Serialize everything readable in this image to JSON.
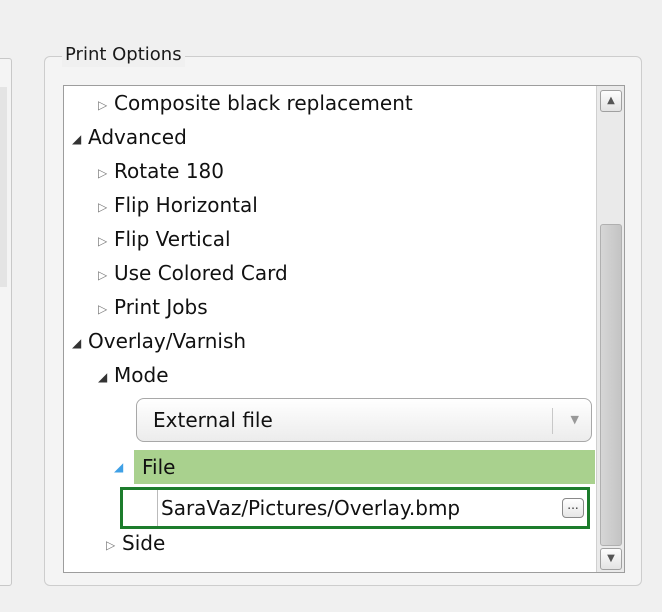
{
  "group_title": "Print Options",
  "tree": {
    "items": [
      {
        "label": "Composite black replacement"
      },
      {
        "label": "Advanced"
      },
      {
        "label": "Rotate 180"
      },
      {
        "label": "Flip Horizontal"
      },
      {
        "label": "Flip Vertical"
      },
      {
        "label": "Use Colored Card"
      },
      {
        "label": "Print Jobs"
      },
      {
        "label": "Overlay/Varnish"
      },
      {
        "label": "Mode"
      },
      {
        "label": "Side"
      }
    ],
    "mode_select": {
      "value": "External file"
    },
    "file_item": {
      "label": "File"
    },
    "file_path": {
      "value": "SaraVaz/Pictures/Overlay.bmp",
      "browse_label": "..."
    }
  },
  "glyphs": {
    "collapsed": "▷",
    "expanded": "◢",
    "combo_arrow": "▼",
    "scroll_up": "▲",
    "scroll_down": "▼"
  },
  "colors": {
    "selected_row": "#a9d18e",
    "focus_border": "#1c7c2c",
    "file_expander": "#3fa0e6"
  }
}
